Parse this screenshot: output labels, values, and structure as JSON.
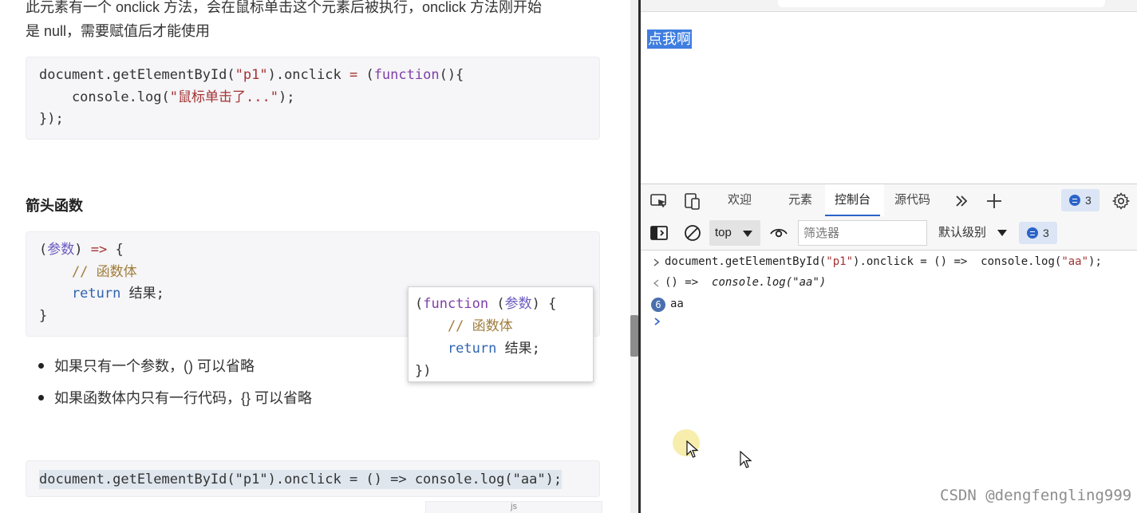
{
  "article": {
    "intro_line1": "此元素有一个 onclick 方法，会在鼠标单击这个元素后被执行，onclick 方法刚开始",
    "intro_line2": "是 null，需要赋值后才能使用",
    "code1": {
      "l1_a": "document.getElementById(",
      "l1_str": "\"p1\"",
      "l1_b": ").onclick ",
      "l1_eq": "=",
      "l1_c": " (",
      "l1_kw": "function",
      "l1_d": "(){",
      "l2_a": "    console.log(",
      "l2_str": "\"鼠标单击了...\"",
      "l2_b": ");",
      "l3": "});"
    },
    "heading_arrow": "箭头函数",
    "code2": {
      "l1_open": "(",
      "l1_param": "参数",
      "l1_close": ") ",
      "l1_arrow": "=>",
      "l1_brace": " {",
      "l2_cmt": "    // 函数体",
      "l3_ret": "    return",
      "l3_rest": " 结果;",
      "l4": "}"
    },
    "bullet1": "如果只有一个参数，() 可以省略",
    "bullet2": "如果函数体内只有一行代码，{} 可以省略",
    "code3": {
      "a": "document.getElementById(",
      "str": "\"p1\"",
      "b": ").onclick = () =>  console.log(",
      "str2": "\"aa\"",
      "c": ");"
    },
    "bottom_fragment": "js",
    "tooltip": {
      "l1_open": "(",
      "l1_kw": "function",
      "l1_mid": " (",
      "l1_param": "参数",
      "l1_close": ") {",
      "l2_cmt": "    // 函数体",
      "l3_ret": "    return",
      "l3_rest": " 结果;",
      "l4": "})"
    }
  },
  "browser": {
    "page_text": "点我啊",
    "devtools": {
      "tabs": [
        "欢迎",
        "元素",
        "控制台",
        "源代码"
      ],
      "active_tab": "控制台",
      "more_icon": "chevron-double-right",
      "add_icon": "plus",
      "issues_count": "3",
      "context": "top",
      "filter_placeholder": "筛选器",
      "levels": "默认级别",
      "toolbar_issues_count": "3",
      "console": {
        "input_cmd_a": "document.getElementById(",
        "input_cmd_str": "\"p1\"",
        "input_cmd_b": ").onclick = () =>  console.log(",
        "input_cmd_str2": "\"aa\"",
        "input_cmd_c": ");",
        "result_a": "() =>  ",
        "result_b": "console.log(\"aa\")",
        "log_count": "6",
        "log_text": "aa"
      }
    },
    "watermark": "CSDN @dengfengling999"
  },
  "colors": {
    "devtools_accent": "#2b63c9",
    "selection": "#3e7ee0",
    "code_string": "#a33434",
    "code_keyword": "#7e3fa8"
  }
}
